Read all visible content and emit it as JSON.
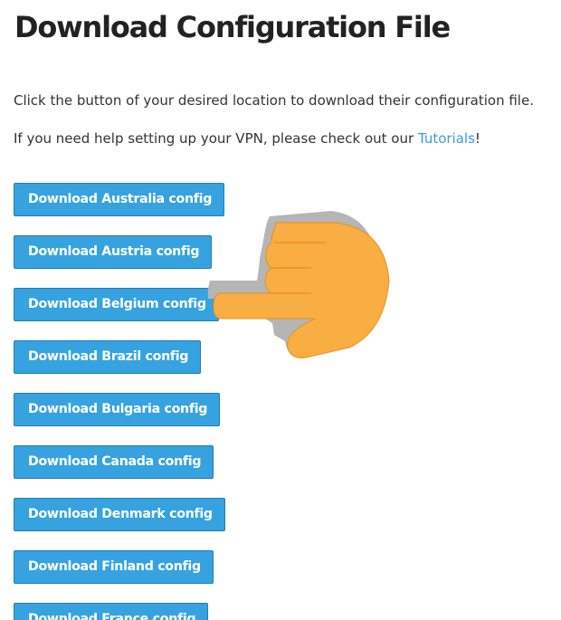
{
  "page": {
    "title": "Download Configuration File",
    "intro_line1": "Click the button of your desired location to download their configuration file.",
    "intro_line2_before": "If you need help setting up your VPN, please check out our ",
    "tutorials_link": "Tutorials",
    "intro_line2_after": "!"
  },
  "buttons": [
    {
      "label": "Download Australia config"
    },
    {
      "label": "Download Austria config"
    },
    {
      "label": "Download Belgium config"
    },
    {
      "label": "Download Brazil config"
    },
    {
      "label": "Download Bulgaria config"
    },
    {
      "label": "Download Canada config"
    },
    {
      "label": "Download Denmark config"
    },
    {
      "label": "Download Finland config"
    },
    {
      "label": "Download France config"
    }
  ],
  "colors": {
    "button_background": "#36a3e0",
    "link": "#3a9bd9",
    "pointer_hand": "#f8ae42"
  },
  "icons": {
    "pointer": "pointing-hand-icon"
  }
}
